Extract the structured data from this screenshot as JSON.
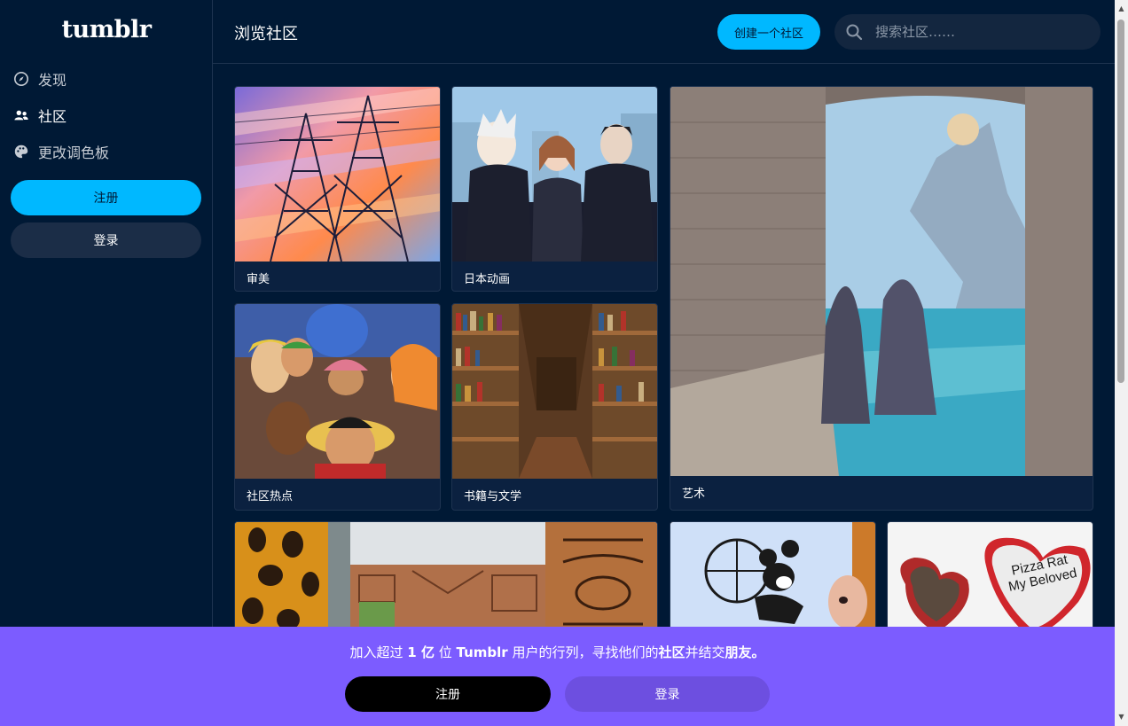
{
  "logo": "tumblr",
  "sidebar": {
    "items": [
      {
        "label": "发现",
        "icon": "compass-icon"
      },
      {
        "label": "社区",
        "icon": "people-icon"
      },
      {
        "label": "更改调色板",
        "icon": "palette-icon"
      }
    ],
    "signup_label": "注册",
    "login_label": "登录"
  },
  "header": {
    "title": "浏览社区",
    "create_label": "创建一个社区",
    "search_placeholder": "搜索社区……"
  },
  "communities": [
    {
      "label": "审美"
    },
    {
      "label": "日本动画"
    },
    {
      "label": "艺术"
    },
    {
      "label": "社区热点"
    },
    {
      "label": "书籍与文学"
    }
  ],
  "partial_cards": {
    "pizza_text_1": "Pizza Rat",
    "pizza_text_2": "My Beloved"
  },
  "banner": {
    "t1": "加入超过 ",
    "t2": "1 亿",
    "t3": " 位 ",
    "t4": "Tumblr",
    "t5": " 用户的行列，寻找他们的",
    "t6": "社区",
    "t7": "并结交",
    "t8": "朋友。",
    "signup_label": "注册",
    "login_label": "登录"
  },
  "colors": {
    "background": "#001935",
    "accent": "#00b8ff",
    "banner": "#7c5cff"
  }
}
